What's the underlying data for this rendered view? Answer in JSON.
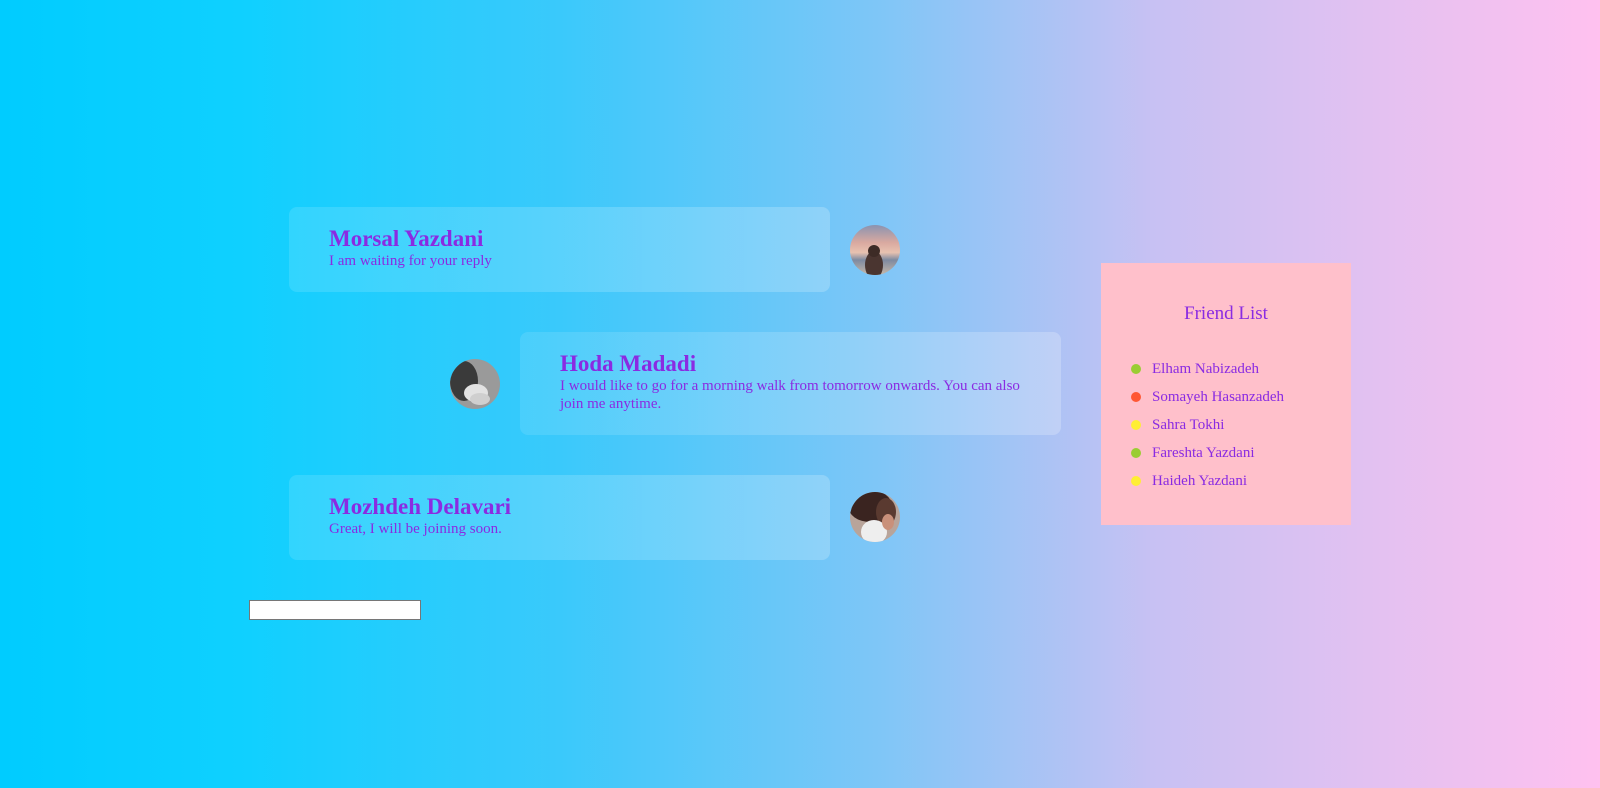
{
  "messages": [
    {
      "name": "Morsal Yazdani",
      "text": "I am waiting for your reply",
      "avatar": "avatar-photo-beach-sunset"
    },
    {
      "name": "Hoda Madadi",
      "text": "I would like to go for a morning walk from tomorrow onwards. You can also join me anytime.",
      "avatar": "avatar-photo-grayscale"
    },
    {
      "name": "Mozhdeh Delavari",
      "text": "Great, I will be joining soon.",
      "avatar": "avatar-photo-portrait"
    }
  ],
  "friends": {
    "title": "Friend List",
    "items": [
      {
        "name": "Elham Nabizadeh",
        "status": "online",
        "color": "#9acd32"
      },
      {
        "name": "Somayeh Hasanzadeh",
        "status": "busy",
        "color": "#ff5733"
      },
      {
        "name": "Sahra Tokhi",
        "status": "away",
        "color": "#ffee33"
      },
      {
        "name": "Fareshta Yazdani",
        "status": "online",
        "color": "#9acd32"
      },
      {
        "name": "Haideh Yazdani",
        "status": "away",
        "color": "#ffee33"
      }
    ]
  },
  "input": {
    "value": "",
    "placeholder": ""
  },
  "colors": {
    "accent_text": "#8a2be2",
    "panel_bg": "#ffc0cb",
    "gradient_start": "#00ccff",
    "gradient_end": "#ffc1ef"
  }
}
